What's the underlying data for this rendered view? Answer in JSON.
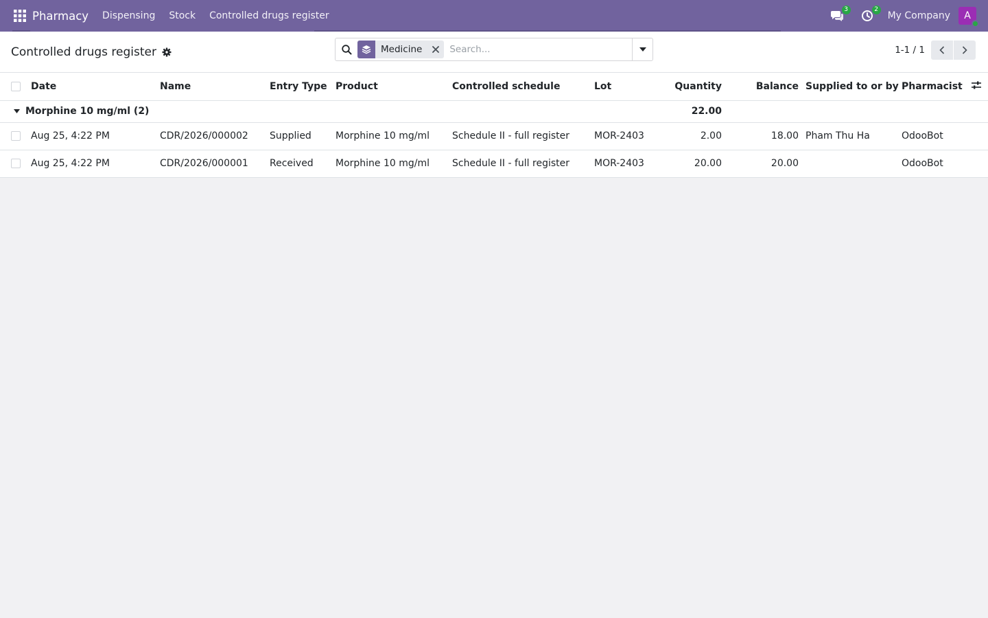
{
  "navbar": {
    "brand": "Pharmacy",
    "menu": [
      "Dispensing",
      "Stock",
      "Controlled drugs register"
    ],
    "messages_count": "3",
    "activities_count": "2",
    "company": "My Company",
    "avatar_initial": "A",
    "colors": {
      "bar": "#71639e",
      "badge": "#28a745",
      "avatar": "#9b2db4"
    }
  },
  "control_panel": {
    "title": "Controlled drugs register",
    "search": {
      "facet_value": "Medicine",
      "placeholder": "Search..."
    },
    "pager": {
      "value": "1-1 / 1"
    }
  },
  "table": {
    "columns": [
      "Date",
      "Name",
      "Entry Type",
      "Product",
      "Controlled schedule",
      "Lot",
      "Quantity",
      "Balance",
      "Supplied to or by",
      "Pharmacist"
    ],
    "group": {
      "label": "Morphine 10 mg/ml (2)",
      "quantity_total": "22.00"
    },
    "rows": [
      {
        "date": "Aug 25, 4:22 PM",
        "name": "CDR/2026/000002",
        "entry_type": "Supplied",
        "product": "Morphine 10 mg/ml",
        "schedule": "Schedule II - full register",
        "lot": "MOR-2403",
        "quantity": "2.00",
        "balance": "18.00",
        "supplied": "Pham Thu Ha",
        "pharmacist": "OdooBot"
      },
      {
        "date": "Aug 25, 4:22 PM",
        "name": "CDR/2026/000001",
        "entry_type": "Received",
        "product": "Morphine 10 mg/ml",
        "schedule": "Schedule II - full register",
        "lot": "MOR-2403",
        "quantity": "20.00",
        "balance": "20.00",
        "supplied": "",
        "pharmacist": "OdooBot"
      }
    ]
  }
}
